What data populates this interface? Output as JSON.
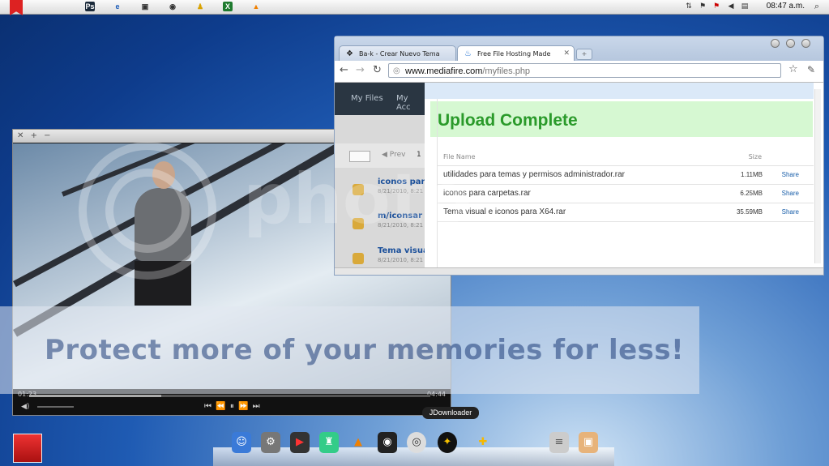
{
  "menubar": {
    "clock": "08:47 a.m.",
    "app_icons": [
      "photoshop-icon",
      "internet-explorer-icon",
      "printer-icon",
      "chrome-icon",
      "aim-icon",
      "excel-icon",
      "vlc-icon"
    ]
  },
  "browser": {
    "tabs": [
      {
        "label": "Ba-k - Crear Nuevo Tema",
        "active": false
      },
      {
        "label": "Free File Hosting Made Simple",
        "active": true
      }
    ],
    "url_host": "www.mediafire.com",
    "url_path": "/myfiles.php",
    "page": {
      "nav": [
        "My Files",
        "My Acc"
      ],
      "toolbar_prev": "Prev",
      "toolbar_page": "1",
      "left_items": [
        {
          "label": "iconos para",
          "sub": "8/21/2010, 8:21"
        },
        {
          "label": "m/iconsar",
          "sub": "8/21/2010, 8:21"
        },
        {
          "label": "Tema visual",
          "sub": "8/21/2010, 8:21"
        }
      ],
      "upload_title": "Upload Complete",
      "columns": {
        "name": "File Name",
        "size": "Size"
      },
      "files": [
        {
          "name": "utilidades para temas y permisos administrador.rar",
          "size": "1.11MB",
          "action": "Share"
        },
        {
          "name": "iconos para carpetas.rar",
          "size": "6.25MB",
          "action": "Share"
        },
        {
          "name": "Tema visual e iconos para X64.rar",
          "size": "35.59MB",
          "action": "Share"
        }
      ]
    }
  },
  "player": {
    "elapsed": "01:23",
    "total": "04:44",
    "progress": 0.33
  },
  "watermark": {
    "text": "photo",
    "promo": "Protect more of your memories for less!"
  },
  "dock": {
    "tooltip": "JDownloader"
  },
  "colors": {
    "upload_green": "#2a9a2a",
    "link_blue": "#1a5faa"
  }
}
